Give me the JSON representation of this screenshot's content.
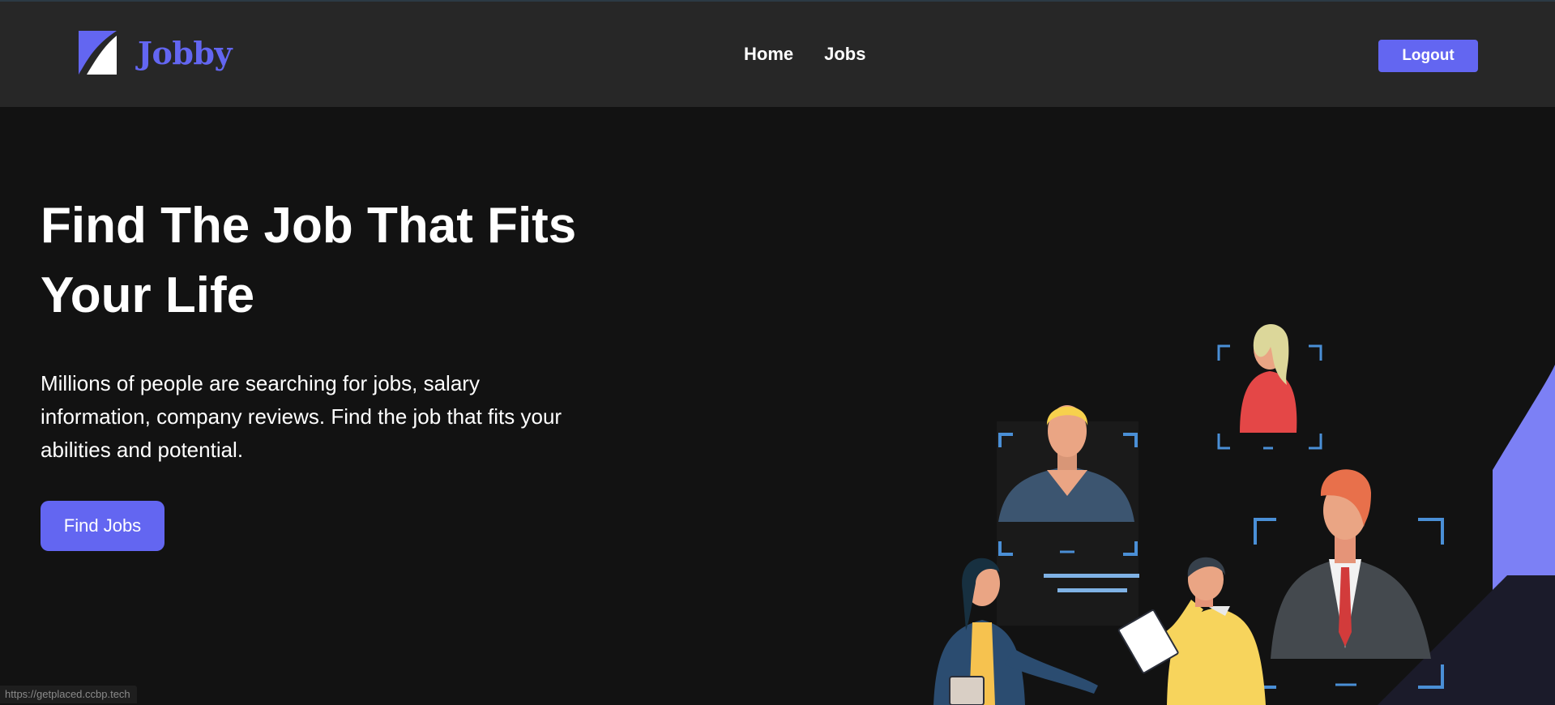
{
  "brand": {
    "name": "Jobby",
    "logo_icon": "jobby-logo-icon",
    "accent_color": "#6366f1"
  },
  "nav": {
    "links": [
      {
        "label": "Home"
      },
      {
        "label": "Jobs"
      }
    ],
    "logout_label": "Logout"
  },
  "hero": {
    "title": "Find The Job That Fits Your Life",
    "description": "Millions of people are searching for jobs, salary information, company reviews. Find the job that fits your abilities and potential.",
    "cta_label": "Find Jobs",
    "illustration": "job-seekers-illustration"
  },
  "status_bar": {
    "url": "https://getplaced.ccbp.tech"
  }
}
